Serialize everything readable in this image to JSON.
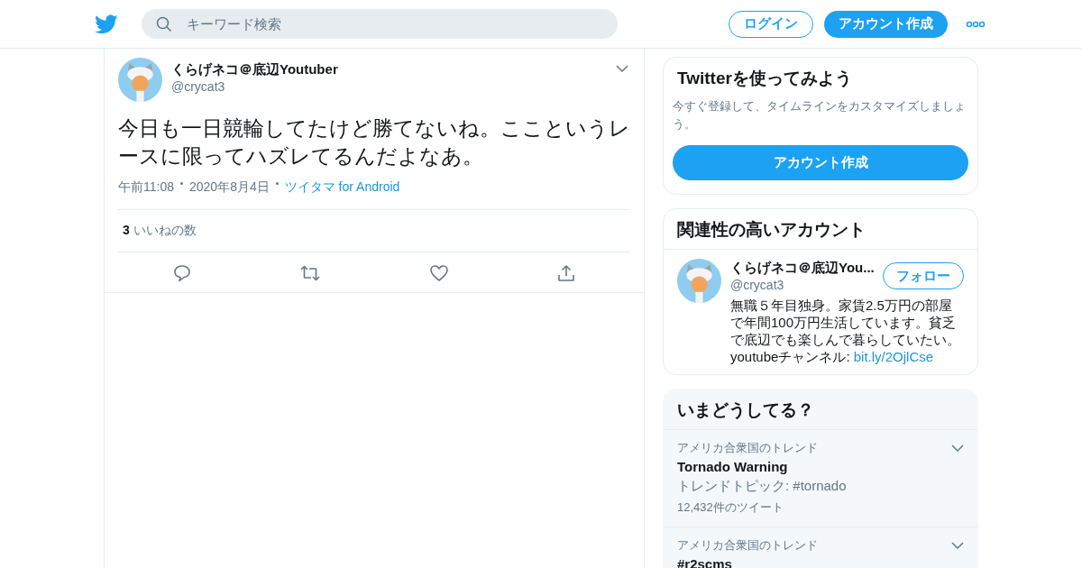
{
  "header": {
    "search": {
      "placeholder": "キーワード検索"
    },
    "login": "ログイン",
    "signup": "アカウント作成"
  },
  "tweet": {
    "name": "くらげネコ＠底辺Youtuber",
    "handle": "@crycat3",
    "text": "今日も一日競輪してたけど勝てないね。ここというレースに限ってハズレてるんだよなあ。",
    "time": "午前11:08",
    "date": "2020年8月4日",
    "source": "ツイタマ for Android",
    "likes_count": "3",
    "likes_label": "いいねの数"
  },
  "signup_card": {
    "title": "Twitterを使ってみよう",
    "text": "今すぐ登録して、タイムラインをカスタマイズしましょう。",
    "button": "アカウント作成"
  },
  "related": {
    "title": "関連性の高いアカウント",
    "accounts": [
      {
        "name": "くらげネコ＠底辺You...",
        "handle": "@crycat3",
        "follow": "フォロー",
        "bio": "無職５年目独身。家賃2.5万円の部屋で年間100万円生活しています。貧乏で底辺でも楽しんで暮らしていたい。youtubeチャンネル: ",
        "link": "bit.ly/2OjlCse"
      }
    ]
  },
  "trends": {
    "title": "いまどうしてる？",
    "items": [
      {
        "region": "アメリカ合衆国のトレンド",
        "name": "Tornado Warning",
        "topic": "トレンドトピック: #tornado",
        "count": "12,432件のツイート"
      },
      {
        "region": "アメリカ合衆国のトレンド",
        "name": "#r2scms"
      }
    ]
  }
}
